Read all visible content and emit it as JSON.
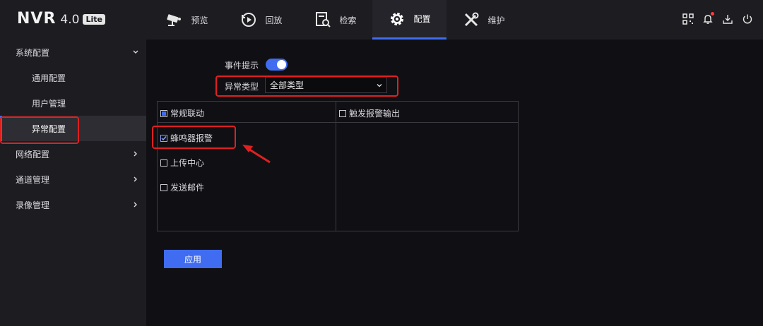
{
  "header": {
    "logo_main": "NVR",
    "logo_version": "4.0",
    "logo_badge": "Lite",
    "tabs": [
      {
        "label": "预览",
        "icon": "camera-icon"
      },
      {
        "label": "回放",
        "icon": "playback-icon"
      },
      {
        "label": "检索",
        "icon": "search-file-icon"
      },
      {
        "label": "配置",
        "icon": "gear-icon",
        "active": true
      },
      {
        "label": "维护",
        "icon": "tools-icon"
      }
    ],
    "right_icons": [
      "qr-code-icon",
      "bell-icon",
      "download-icon",
      "power-icon"
    ]
  },
  "sidebar": {
    "groups": [
      {
        "label": "系统配置",
        "expanded": true
      },
      {
        "label": "网络配置"
      },
      {
        "label": "通道管理"
      },
      {
        "label": "录像管理"
      }
    ],
    "items": [
      {
        "label": "通用配置"
      },
      {
        "label": "用户管理"
      },
      {
        "label": "异常配置",
        "active": true
      }
    ]
  },
  "form": {
    "event_hint_label": "事件提示",
    "event_hint_enabled": true,
    "exception_type_label": "异常类型",
    "exception_type_value": "全部类型",
    "linkage_header": "常规联动",
    "trigger_header": "触发报警输出",
    "options": [
      {
        "label": "蜂鸣器报警",
        "checked": true
      },
      {
        "label": "上传中心",
        "checked": false
      },
      {
        "label": "发送邮件",
        "checked": false
      }
    ],
    "apply_label": "应用"
  },
  "colors": {
    "accent": "#3f6cf0",
    "annotation": "#e02020",
    "background": "#101014",
    "panel": "#1c1c21"
  }
}
